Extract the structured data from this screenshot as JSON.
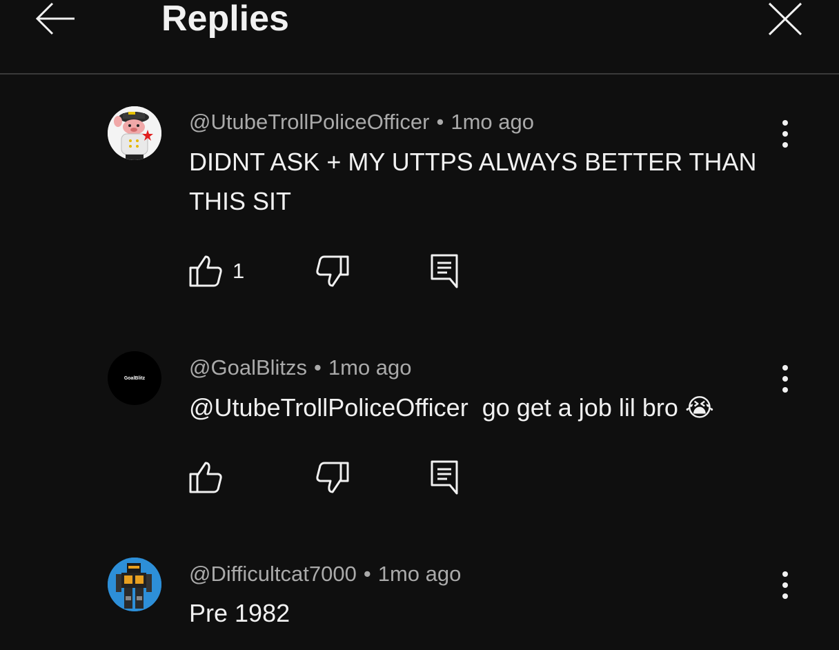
{
  "header": {
    "title": "Replies",
    "back_icon": "arrow-left-icon",
    "close_icon": "close-icon"
  },
  "comments": [
    {
      "author": "@UtubeTrollPoliceOfficer",
      "separator": "•",
      "time": "1mo ago",
      "text": "DIDNT ASK + MY UTTPS ALWAYS BETTER THAN THIS SIT",
      "likes": "1",
      "avatar_desc": "cartoon police officer"
    },
    {
      "author": "@GoalBlitzs",
      "separator": "•",
      "time": "1mo ago",
      "text": "@UtubeTrollPoliceOfficer  go get a job lil bro",
      "emoji": "😭",
      "likes": "",
      "avatar_text": "GoalBlitz"
    },
    {
      "author": "@Difficultcat7000",
      "separator": "•",
      "time": "1mo ago",
      "text": "Pre 1982",
      "likes": "",
      "avatar_desc": "robot toy"
    }
  ],
  "icons": {
    "like": "thumbs-up-icon",
    "dislike": "thumbs-down-icon",
    "reply": "reply-icon",
    "more": "more-vertical-icon"
  },
  "colors": {
    "background": "#0f0f0f",
    "text": "#f1f1f1",
    "secondary_text": "#aaaaaa",
    "divider": "#3a3a3a"
  }
}
